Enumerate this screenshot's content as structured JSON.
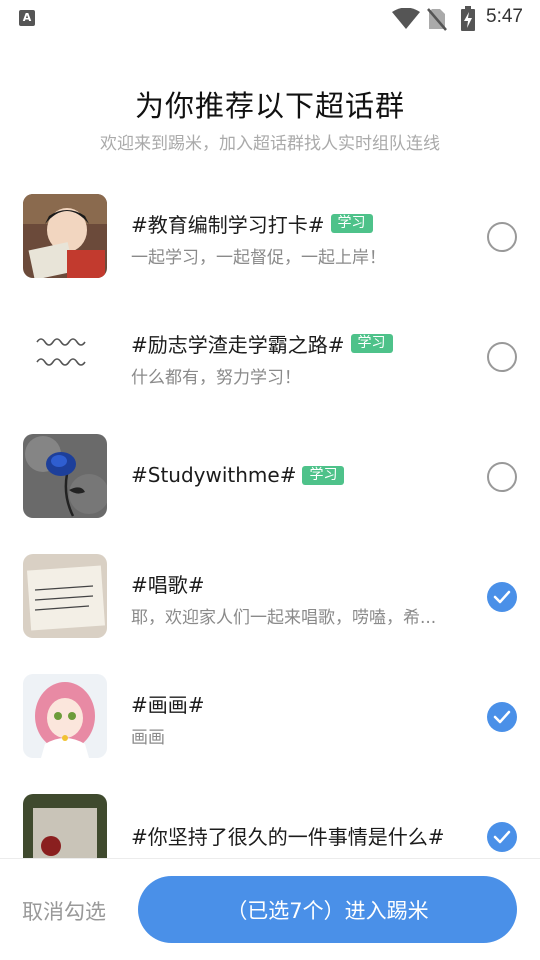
{
  "status_bar": {
    "time": "5:47",
    "notification_icon": "a-letter-icon"
  },
  "header": {
    "title": "为你推荐以下超话群",
    "subtitle": "欢迎来到踢米，加入超话群找人实时组队连线"
  },
  "groups": [
    {
      "name": "#教育编制学习打卡#",
      "tag": "学习",
      "desc": "一起学习，一起督促，一起上岸！",
      "selected": false,
      "avatar": "boy-reading-avatar"
    },
    {
      "name": "#励志学渣走学霸之路#",
      "tag": "学习",
      "desc": "什么都有，努力学习！",
      "selected": false,
      "avatar": "calligraphy-avatar",
      "avatar_text": "埋头读书\n不问世事"
    },
    {
      "name": "#Studywithme#",
      "tag": "学习",
      "desc": "",
      "selected": false,
      "avatar": "blue-rose-avatar"
    },
    {
      "name": "#唱歌#",
      "tag": "",
      "desc": "耶，欢迎家人们一起来唱歌，唠嗑，希...",
      "selected": true,
      "avatar": "handwritten-note-avatar"
    },
    {
      "name": "#画画#",
      "tag": "",
      "desc": "画画",
      "selected": true,
      "avatar": "anime-girl-avatar"
    },
    {
      "name": "#你坚持了很久的一件事情是什么#",
      "tag": "",
      "desc": "",
      "selected": true,
      "avatar": "rose-on-stone-avatar"
    }
  ],
  "footer": {
    "cancel_label": "取消勾选",
    "enter_label": "（已选7个）进入踢米"
  },
  "colors": {
    "accent": "#4a90e8",
    "tag": "#4ec28a"
  }
}
